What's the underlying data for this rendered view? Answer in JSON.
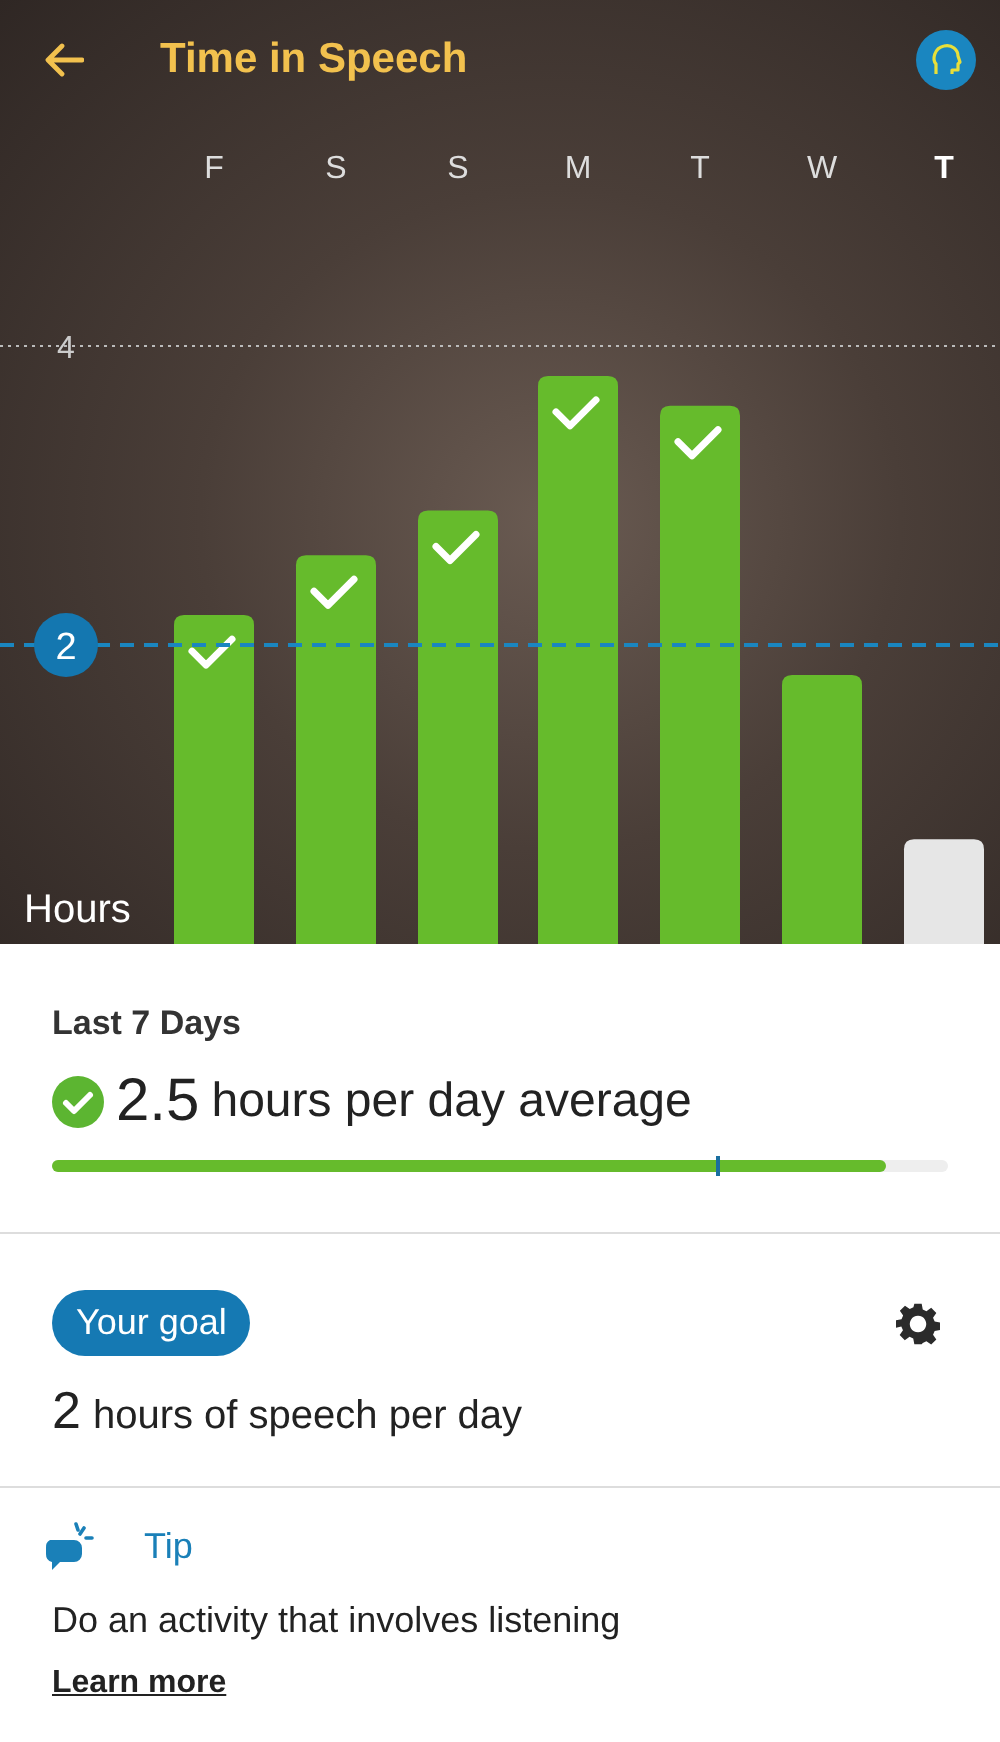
{
  "header": {
    "title": "Time in Speech"
  },
  "chart": {
    "chart_data": {
      "type": "bar",
      "categories": [
        "F",
        "S",
        "S",
        "M",
        "T",
        "W",
        "T"
      ],
      "series": [
        {
          "color": "#66bb2c",
          "values": [
            2.2,
            2.6,
            2.9,
            3.8,
            3.6,
            1.8,
            null
          ]
        },
        {
          "color": "#e6e6e6",
          "values": [
            null,
            null,
            null,
            null,
            null,
            null,
            0.7
          ]
        }
      ],
      "ylabel": "Hours",
      "ylim": [
        0,
        4
      ],
      "yticks": [
        4
      ],
      "ref_lines": [
        {
          "axis": "y",
          "value": 2,
          "label": "2",
          "color": "#1a86c0"
        }
      ]
    },
    "days": [
      {
        "today": false
      },
      {
        "today": false
      },
      {
        "today": false
      },
      {
        "today": false
      },
      {
        "today": false
      },
      {
        "today": false
      },
      {
        "today": true
      }
    ]
  },
  "summary": {
    "title": "Last 7 Days",
    "value": "2.5",
    "unit": "hours per day average",
    "goal_met": true,
    "progress": {
      "level": 0.93
    },
    "goal_mark": {
      "level": 0.74
    }
  },
  "goal": {
    "badge": "Your goal",
    "value": "2",
    "unit": "hours of speech per day"
  },
  "tip": {
    "title": "Tip",
    "text": "Do an activity that involves listening",
    "link": "Learn more"
  }
}
